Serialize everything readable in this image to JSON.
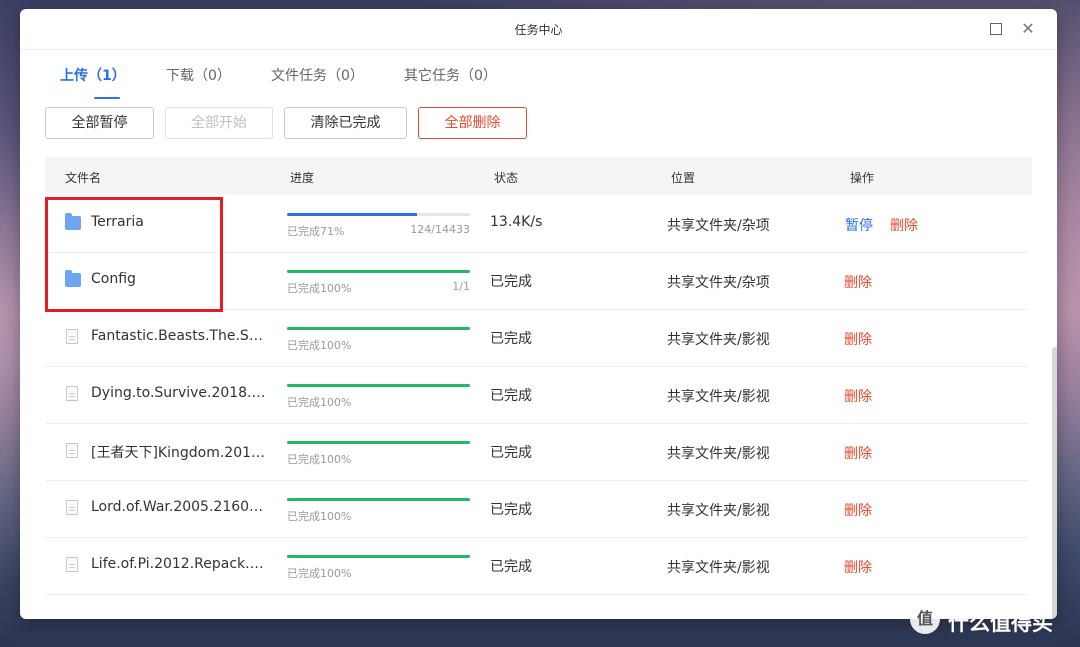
{
  "window": {
    "title": "任务中心"
  },
  "tabs": [
    {
      "label": "上传（1）"
    },
    {
      "label": "下载（0）"
    },
    {
      "label": "文件任务（0）"
    },
    {
      "label": "其它任务（0）"
    }
  ],
  "toolbar": {
    "pause_all": "全部暂停",
    "start_all": "全部开始",
    "clear_completed": "清除已完成",
    "delete_all": "全部删除"
  },
  "table": {
    "headers": {
      "name": "文件名",
      "progress": "进度",
      "status": "状态",
      "location": "位置",
      "actions": "操作"
    },
    "rows": [
      {
        "name": "Terraria",
        "icon": "folder-icon",
        "progress": 0.71,
        "progress_text": "已完成71%",
        "count": "124/14433",
        "status": "13.4K/s",
        "location": "共享文件夹/杂项",
        "pause": "暂停",
        "delete": "删除"
      },
      {
        "name": "Config",
        "icon": "folder-icon",
        "progress": 1.0,
        "progress_text": "已完成100%",
        "count": "1/1",
        "status": "已完成",
        "location": "共享文件夹/杂项",
        "delete": "删除"
      },
      {
        "name": "Fantastic.Beasts.The.Se...",
        "icon": "file-icon",
        "progress": 1.0,
        "progress_text": "已完成100%",
        "status": "已完成",
        "location": "共享文件夹/影视",
        "delete": "删除"
      },
      {
        "name": "Dying.to.Survive.2018.21...",
        "icon": "file-icon",
        "progress": 1.0,
        "progress_text": "已完成100%",
        "status": "已完成",
        "location": "共享文件夹/影视",
        "delete": "删除"
      },
      {
        "name": "[王者天下]Kingdom.2019....",
        "icon": "file-icon",
        "progress": 1.0,
        "progress_text": "已完成100%",
        "status": "已完成",
        "location": "共享文件夹/影视",
        "delete": "删除"
      },
      {
        "name": "Lord.of.War.2005.2160p....",
        "icon": "file-icon",
        "progress": 1.0,
        "progress_text": "已完成100%",
        "status": "已完成",
        "location": "共享文件夹/影视",
        "delete": "删除"
      },
      {
        "name": "Life.of.Pi.2012.Repack.U...",
        "icon": "file-icon",
        "progress": 1.0,
        "progress_text": "已完成100%",
        "status": "已完成",
        "location": "共享文件夹/影视",
        "delete": "删除"
      }
    ]
  },
  "colors": {
    "accent": "#2a70e8",
    "danger": "#e8492f",
    "success": "#21b865",
    "in_progress": "#2a70e8"
  },
  "watermark": {
    "logo": "值",
    "text": "什么值得买"
  }
}
